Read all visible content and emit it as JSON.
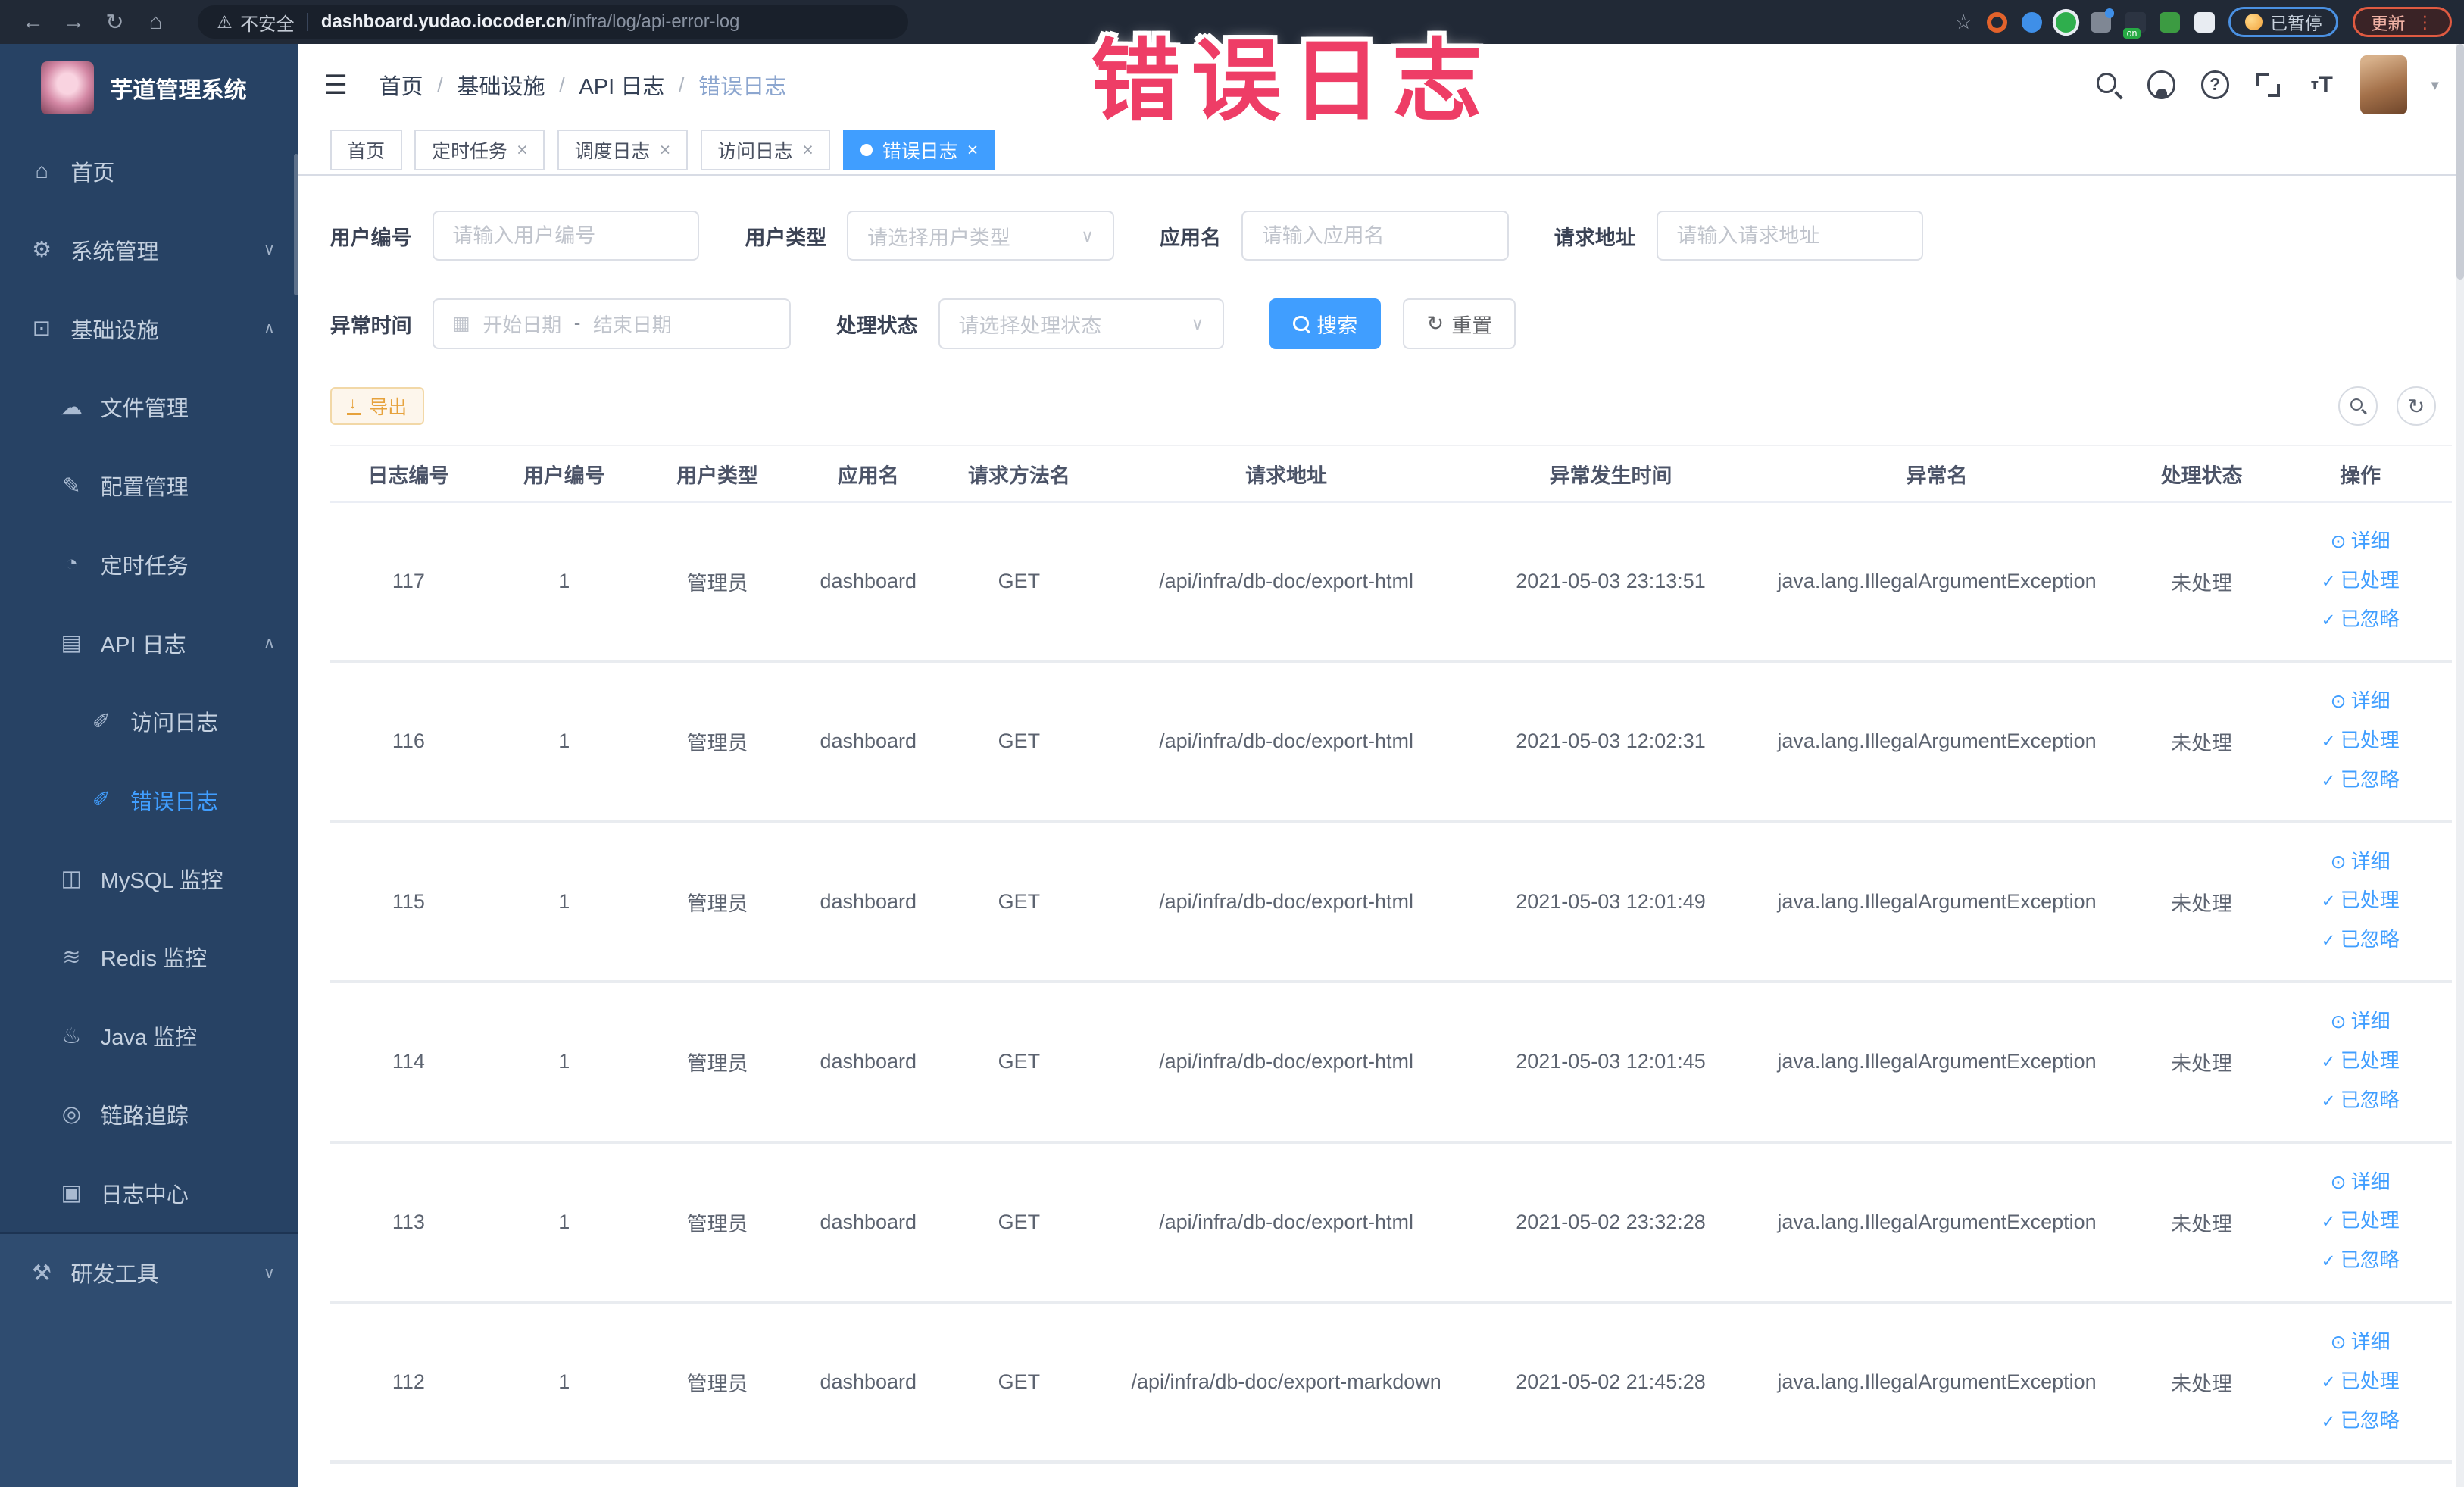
{
  "overlay": {
    "title": "错误日志",
    "color": "#ee3d66"
  },
  "browser": {
    "security_label": "不安全",
    "url_host": "dashboard.yudao.iocoder.cn",
    "url_path": "/infra/log/api-error-log",
    "nav_icons": [
      "back",
      "forward",
      "reload",
      "home"
    ],
    "toolbar_icons": [
      "bookmark-star",
      "ext-orange",
      "ext-shield-blue",
      "ext-green",
      "ext-grid-blue",
      "ext-on-badge",
      "ext-leaf-green",
      "ext-puzzle-white"
    ],
    "paused_label": "已暂停",
    "update_label": "更新"
  },
  "sidebar": {
    "app_title": "芋道管理系统",
    "menu": [
      {
        "key": "home",
        "label": "首页",
        "level": 1,
        "icon": "home"
      },
      {
        "key": "system-management",
        "label": "系统管理",
        "level": 1,
        "icon": "gear",
        "arrow": "down"
      },
      {
        "key": "infrastructure",
        "label": "基础设施",
        "level": 1,
        "icon": "infra",
        "arrow": "up"
      },
      {
        "key": "file-management",
        "label": "文件管理",
        "level": 2,
        "icon": "cloud"
      },
      {
        "key": "config-management",
        "label": "配置管理",
        "level": 2,
        "icon": "edit"
      },
      {
        "key": "scheduled-tasks",
        "label": "定时任务",
        "level": 2,
        "icon": "timer"
      },
      {
        "key": "api-log",
        "label": "API 日志",
        "level": 2,
        "icon": "api-log",
        "arrow": "up"
      },
      {
        "key": "access-log",
        "label": "访问日志",
        "level": 3,
        "icon": "doc"
      },
      {
        "key": "error-log",
        "label": "错误日志",
        "level": 3,
        "icon": "doc",
        "active": true
      },
      {
        "key": "mysql-monitor",
        "label": "MySQL 监控",
        "level": 2,
        "icon": "mysql"
      },
      {
        "key": "redis-monitor",
        "label": "Redis 监控",
        "level": 2,
        "icon": "redis"
      },
      {
        "key": "java-monitor",
        "label": "Java 监控",
        "level": 2,
        "icon": "java"
      },
      {
        "key": "link-trace",
        "label": "链路追踪",
        "level": 2,
        "icon": "trace"
      },
      {
        "key": "log-center",
        "label": "日志中心",
        "level": 2,
        "icon": "log-center"
      },
      {
        "key": "dev-tools",
        "label": "研发工具",
        "level": 1,
        "icon": "tools",
        "arrow": "down",
        "section": "dev"
      }
    ]
  },
  "header": {
    "breadcrumb": [
      "首页",
      "基础设施",
      "API 日志",
      "错误日志"
    ],
    "action_icons": [
      "search",
      "github",
      "help",
      "fullscreen",
      "font-size"
    ]
  },
  "tabs": [
    {
      "label": "首页",
      "closable": false,
      "active": false
    },
    {
      "label": "定时任务",
      "closable": true,
      "active": false
    },
    {
      "label": "调度日志",
      "closable": true,
      "active": false
    },
    {
      "label": "访问日志",
      "closable": true,
      "active": false
    },
    {
      "label": "错误日志",
      "closable": true,
      "active": true
    }
  ],
  "filters": {
    "user_id": {
      "label": "用户编号",
      "placeholder": "请输入用户编号"
    },
    "user_type": {
      "label": "用户类型",
      "placeholder": "请选择用户类型"
    },
    "app_name": {
      "label": "应用名",
      "placeholder": "请输入应用名"
    },
    "request_url": {
      "label": "请求地址",
      "placeholder": "请输入请求地址"
    },
    "exception_time": {
      "label": "异常时间",
      "start_placeholder": "开始日期",
      "separator": "-",
      "end_placeholder": "结束日期"
    },
    "process_status": {
      "label": "处理状态",
      "placeholder": "请选择处理状态"
    },
    "search_label": "搜索",
    "reset_label": "重置"
  },
  "toolbar": {
    "export_label": "导出"
  },
  "table": {
    "columns": [
      "日志编号",
      "用户编号",
      "用户类型",
      "应用名",
      "请求方法名",
      "请求地址",
      "异常发生时间",
      "异常名",
      "处理状态",
      "操作"
    ],
    "ops": [
      {
        "icon": "view",
        "label": "详细"
      },
      {
        "icon": "check",
        "label": "已处理"
      },
      {
        "icon": "check",
        "label": "已忽略"
      }
    ],
    "rows": [
      {
        "id": "117",
        "user_id": "1",
        "user_type": "管理员",
        "app_name": "dashboard",
        "method": "GET",
        "url": "/api/infra/db-doc/export-html",
        "time": "2021-05-03 23:13:51",
        "exception": "java.lang.IllegalArgumentException",
        "status": "未处理"
      },
      {
        "id": "116",
        "user_id": "1",
        "user_type": "管理员",
        "app_name": "dashboard",
        "method": "GET",
        "url": "/api/infra/db-doc/export-html",
        "time": "2021-05-03 12:02:31",
        "exception": "java.lang.IllegalArgumentException",
        "status": "未处理"
      },
      {
        "id": "115",
        "user_id": "1",
        "user_type": "管理员",
        "app_name": "dashboard",
        "method": "GET",
        "url": "/api/infra/db-doc/export-html",
        "time": "2021-05-03 12:01:49",
        "exception": "java.lang.IllegalArgumentException",
        "status": "未处理"
      },
      {
        "id": "114",
        "user_id": "1",
        "user_type": "管理员",
        "app_name": "dashboard",
        "method": "GET",
        "url": "/api/infra/db-doc/export-html",
        "time": "2021-05-03 12:01:45",
        "exception": "java.lang.IllegalArgumentException",
        "status": "未处理"
      },
      {
        "id": "113",
        "user_id": "1",
        "user_type": "管理员",
        "app_name": "dashboard",
        "method": "GET",
        "url": "/api/infra/db-doc/export-html",
        "time": "2021-05-02 23:32:28",
        "exception": "java.lang.IllegalArgumentException",
        "status": "未处理"
      },
      {
        "id": "112",
        "user_id": "1",
        "user_type": "管理员",
        "app_name": "dashboard",
        "method": "GET",
        "url": "/api/infra/db-doc/export-markdown",
        "time": "2021-05-02 21:45:28",
        "exception": "java.lang.IllegalArgumentException",
        "status": "未处理"
      }
    ]
  }
}
